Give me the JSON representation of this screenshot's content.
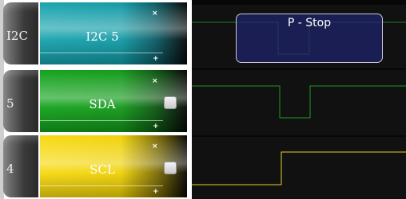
{
  "channels": [
    {
      "number": "I2C",
      "name": "I2C 5",
      "close_glyph": "×",
      "expand_glyph": "+",
      "color": "#17a3ad",
      "has_checkbox": false
    },
    {
      "number": "5",
      "name": "SDA",
      "close_glyph": "×",
      "expand_glyph": "+",
      "color": "#13a31c",
      "has_checkbox": true
    },
    {
      "number": "4",
      "name": "SCL",
      "close_glyph": "×",
      "expand_glyph": "+",
      "color": "#f7d910",
      "has_checkbox": true
    }
  ],
  "waveform": {
    "protocol_label": "P - Stop",
    "colors": {
      "i2c_trace": "#1f7a24",
      "sda_trace": "#1f9a24",
      "scl_trace": "#e8cf2a",
      "annotation_fill": "#20246e",
      "annotation_border": "#c9c9d8"
    }
  }
}
